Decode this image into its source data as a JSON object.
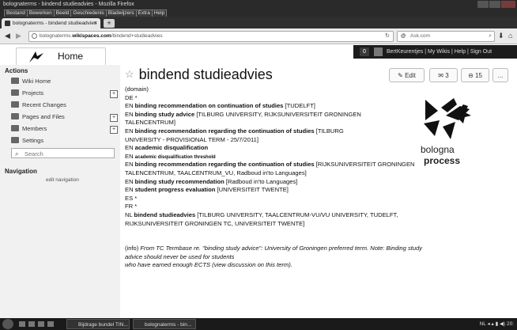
{
  "browser": {
    "window_title": "bolognaterms - bindend studieadvies - Mozilla Firefox",
    "menu": [
      "Bestand",
      "Bewerken",
      "Beeld",
      "Geschiedenis",
      "Bladwijzers",
      "Extra",
      "Help"
    ],
    "tab_label": "bolognaterms - bindend studieadvies",
    "tab_close": "×",
    "new_tab": "+",
    "url_prefix": "bolognaterms.",
    "url_domain": "wikispaces.com",
    "url_path": "/bindend+studieadvies",
    "search_engine": "Ask.com",
    "nav_back": "◀",
    "nav_forward": "▶",
    "reload": "↻"
  },
  "site": {
    "home_label": "Home",
    "notification_count": "0",
    "user_links": "BertKeurentjes | My Wikis | Help | Sign Out"
  },
  "sidebar": {
    "actions_heading": "Actions",
    "items": [
      {
        "label": "Wiki Home",
        "icon": "home-icon"
      },
      {
        "label": "Projects",
        "icon": "projects-icon"
      },
      {
        "label": "Recent Changes",
        "icon": "calendar-icon"
      },
      {
        "label": "Pages and Files",
        "icon": "pages-icon"
      },
      {
        "label": "Members",
        "icon": "members-icon"
      },
      {
        "label": "Settings",
        "icon": "settings-icon"
      }
    ],
    "search_placeholder": "Search",
    "navigation_heading": "Navigation",
    "edit_navigation": "edit navigation"
  },
  "page": {
    "title": "bindend studieadvies",
    "edit_label": "Edit",
    "badge_count": "3",
    "view_count": "15",
    "more_label": "...",
    "lines": [
      {
        "segments": [
          {
            "t": "(domain)"
          }
        ]
      },
      {
        "segments": [
          {
            "t": "DE *"
          }
        ]
      },
      {
        "segments": [
          {
            "t": "EN "
          },
          {
            "t": "binding recommendation on continuation of studies",
            "b": true
          },
          {
            "t": " [TUDELFT]"
          }
        ]
      },
      {
        "segments": [
          {
            "t": "EN "
          },
          {
            "t": "binding study advice",
            "b": true
          },
          {
            "t": " [TILBURG UNIVERSITY, RIJKSUNIVERSITEIT GRONINGEN"
          }
        ]
      },
      {
        "segments": [
          {
            "t": "TALENCENTRUM]"
          }
        ]
      },
      {
        "segments": [
          {
            "t": "EN "
          },
          {
            "t": "binding recommendation regarding the continuation of studies",
            "b": true
          },
          {
            "t": " [TILBURG"
          }
        ]
      },
      {
        "segments": [
          {
            "t": "UNIVERSITY - PROVISIONAL TERM - 25/7/2011]"
          }
        ]
      },
      {
        "segments": [
          {
            "t": "EN "
          },
          {
            "t": "academic disqualification",
            "b": true
          }
        ]
      },
      {
        "segments": [
          {
            "t": "EN "
          },
          {
            "t": "academic disqualification threshold",
            "b": true,
            "s": true
          }
        ]
      },
      {
        "segments": [
          {
            "t": "EN "
          },
          {
            "t": "binding recommendation regarding the continuation of studies",
            "b": true
          },
          {
            "t": " [RIJKSUNIVERSITEIT GRONINGEN"
          }
        ]
      },
      {
        "segments": [
          {
            "t": "TALENCENTRUM, TAALCENTRUM_VU, Radboud in'to Languages]"
          }
        ]
      },
      {
        "segments": [
          {
            "t": "EN "
          },
          {
            "t": "binding study recommendation",
            "b": true
          },
          {
            "t": " [Radboud in'to Languages]"
          }
        ]
      },
      {
        "segments": [
          {
            "t": "EN "
          },
          {
            "t": "student progress evaluation",
            "b": true
          },
          {
            "t": " [UNIVERSITEIT TWENTE]"
          }
        ]
      },
      {
        "segments": [
          {
            "t": "ES *"
          }
        ]
      },
      {
        "segments": [
          {
            "t": "FR *"
          }
        ]
      },
      {
        "segments": [
          {
            "t": "NL "
          },
          {
            "t": "bindend studieadvies",
            "b": true
          },
          {
            "t": " [TILBURG UNIVERSITY, TAALCENTRUM-VU/VU UNIVERSITY, TUDELFT,"
          }
        ]
      },
      {
        "segments": [
          {
            "t": "RIJKSUNIVERSITEIT GRONINGEN TC, UNIVERSITEIT TWENTE]"
          }
        ]
      },
      {
        "segments": [
          {
            "t": ""
          }
        ]
      },
      {
        "segments": [
          {
            "t": ""
          }
        ]
      },
      {
        "segments": [
          {
            "t": "(info) "
          },
          {
            "t": "From TC Termbase re. \"binding study advice\": University of Groningen preferred term. Note: Binding study",
            "i": true
          }
        ]
      },
      {
        "segments": [
          {
            "t": "advice should never be used for students",
            "i": true
          }
        ]
      },
      {
        "segments": [
          {
            "t": "who have earned enough ECTS (view discussion on this term).",
            "i": true
          }
        ]
      }
    ],
    "logo_word1": "bologna",
    "logo_word2": "process"
  },
  "taskbar": {
    "items": [
      "Bijdrage bundel TIN...",
      "bolognaterms - bin..."
    ],
    "tray": "NL  ◂ ▴ ▮ ◀) 20:"
  }
}
